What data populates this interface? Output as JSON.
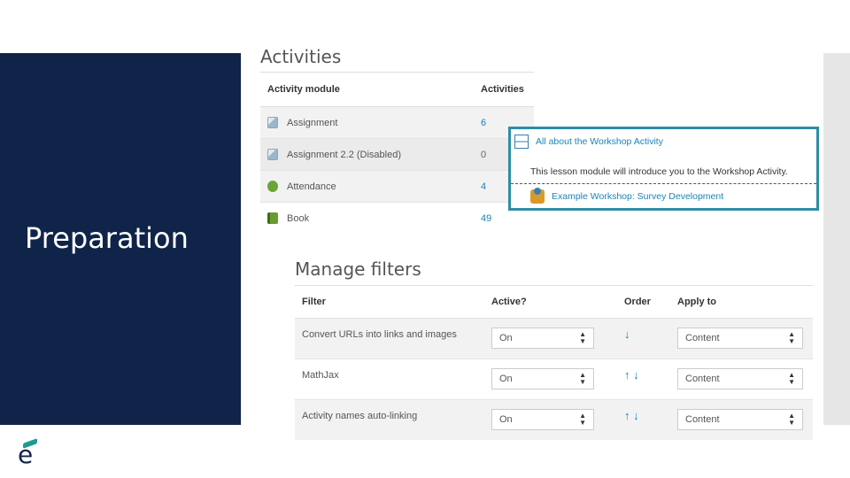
{
  "slide": {
    "title": "Preparation"
  },
  "colors": {
    "navy": "#10244a",
    "accent": "#1c9b8e",
    "link": "#1a85b8",
    "callout_border": "#2d8da6"
  },
  "activities": {
    "title": "Activities",
    "headers": {
      "module": "Activity module",
      "count": "Activities"
    },
    "rows": [
      {
        "name": "Assignment",
        "count": "6",
        "icon": "assignment-icon"
      },
      {
        "name": "Assignment 2.2 (Disabled)",
        "count": "0",
        "icon": "assignment-icon"
      },
      {
        "name": "Attendance",
        "count": "4",
        "icon": "attendance-icon"
      },
      {
        "name": "Book",
        "count": "49",
        "icon": "book-icon"
      }
    ]
  },
  "workshop": {
    "lesson_link": "All about the Workshop Activity",
    "description": "This lesson module will introduce you to the Workshop Activity.",
    "workshop_link": "Example Workshop: Survey Development"
  },
  "filters": {
    "title": "Manage filters",
    "headers": {
      "filter": "Filter",
      "active": "Active?",
      "order": "Order",
      "apply": "Apply to"
    },
    "rows": [
      {
        "name": "Convert URLs into links and images",
        "active": "On",
        "order": "↓",
        "apply": "Content"
      },
      {
        "name": "MathJax",
        "active": "On",
        "order": "↑ ↓",
        "apply": "Content"
      },
      {
        "name": "Activity names auto-linking",
        "active": "On",
        "order": "↑ ↓",
        "apply": "Content"
      }
    ]
  }
}
